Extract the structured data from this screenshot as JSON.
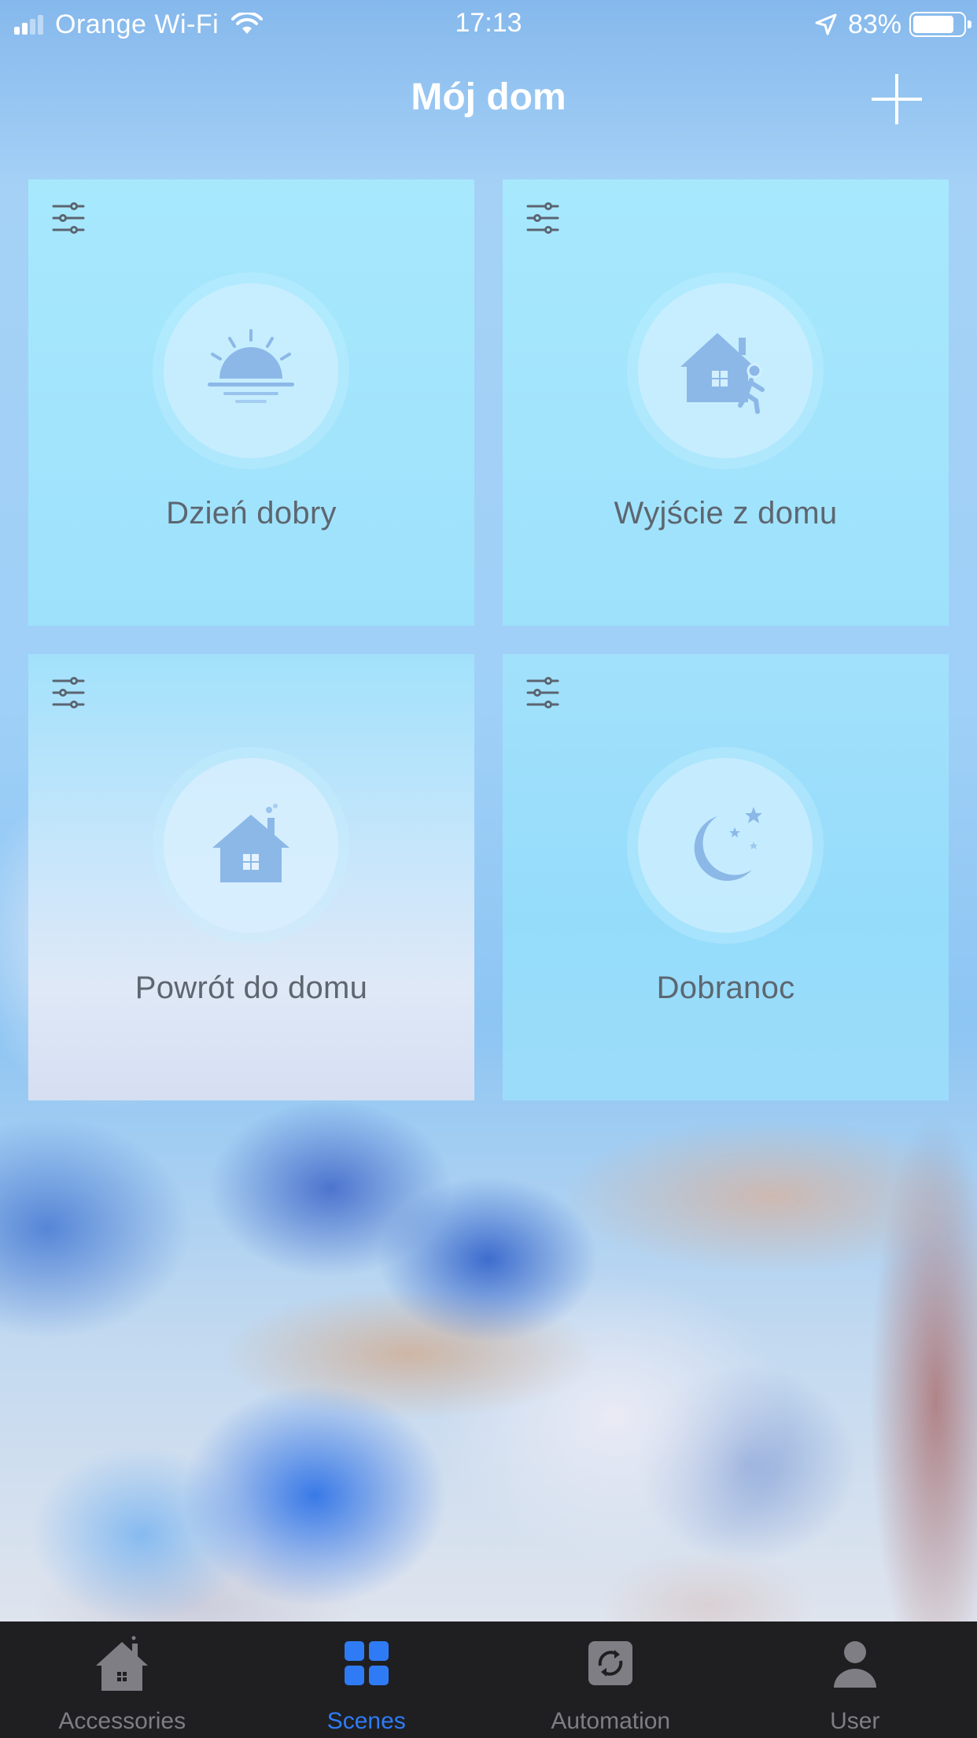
{
  "status_bar": {
    "carrier": "Orange Wi-Fi",
    "time": "17:13",
    "battery": "83%",
    "battery_level": 0.83
  },
  "header": {
    "title": "Mój dom",
    "add_icon": "plus-icon"
  },
  "scenes": [
    {
      "label": "Dzień dobry",
      "icon": "sunrise-icon"
    },
    {
      "label": "Wyjście z domu",
      "icon": "leave-home-icon"
    },
    {
      "label": "Powrót do domu",
      "icon": "home-icon"
    },
    {
      "label": "Dobranoc",
      "icon": "moon-stars-icon"
    }
  ],
  "tab_bar": {
    "active": "Scenes",
    "accent_color": "#2f7bf5",
    "tabs": [
      {
        "label": "Accessories",
        "icon": "house-icon"
      },
      {
        "label": "Scenes",
        "icon": "grid-icon"
      },
      {
        "label": "Automation",
        "icon": "automation-icon"
      },
      {
        "label": "User",
        "icon": "user-icon"
      }
    ]
  }
}
